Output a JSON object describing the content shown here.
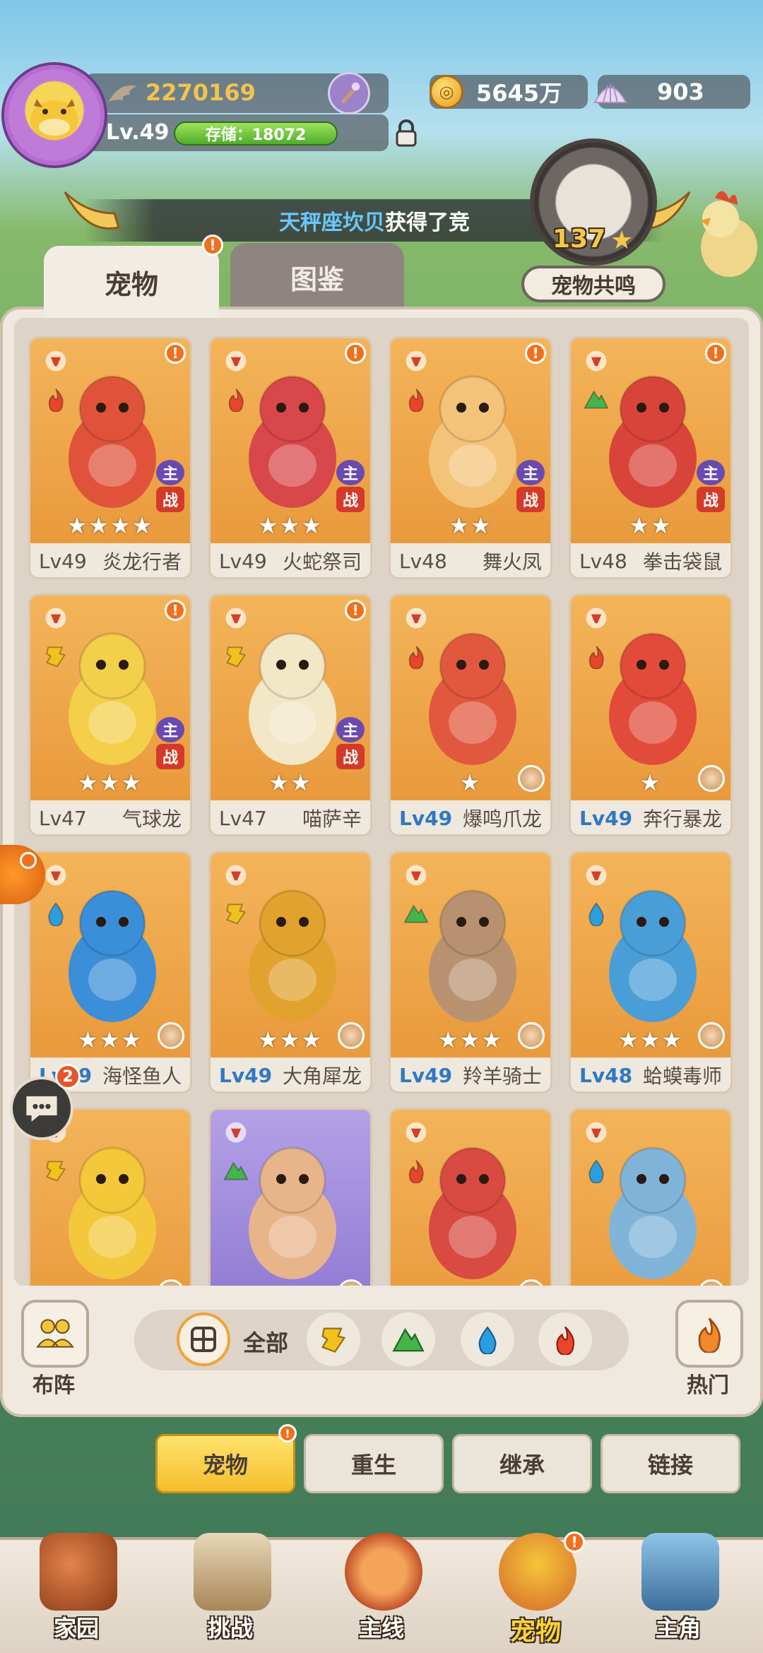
{
  "header": {
    "score": "2270169",
    "level": "Lv.49",
    "storage": "存储：18072",
    "gold": "5645万",
    "shells": "903"
  },
  "marquee": {
    "highlight": "天秤座坎贝",
    "text": "获得了竞"
  },
  "resonance": {
    "count": "137",
    "label": "宠物共鸣"
  },
  "tabs": [
    {
      "label": "宠物",
      "badge": "!"
    },
    {
      "label": "图鉴"
    }
  ],
  "pets": [
    {
      "lv": "Lv49",
      "name": "炎龙行者",
      "stars": "★★★★",
      "badge": true,
      "main": true
    },
    {
      "lv": "Lv49",
      "name": "火蛇祭司",
      "stars": "★★★",
      "badge": true,
      "main": true
    },
    {
      "lv": "Lv48",
      "name": "舞火凤",
      "stars": "★★",
      "badge": true,
      "main": true
    },
    {
      "lv": "Lv48",
      "name": "拳击袋鼠",
      "stars": "★★",
      "badge": true,
      "main": true
    },
    {
      "lv": "Lv47",
      "name": "气球龙",
      "stars": "★★★",
      "badge": true,
      "main": true
    },
    {
      "lv": "Lv47",
      "name": "喵萨辛",
      "stars": "★★",
      "badge": true,
      "main": true
    },
    {
      "lv": "Lv49",
      "name": "爆鸣爪龙",
      "stars": "★",
      "lvBlue": true
    },
    {
      "lv": "Lv49",
      "name": "奔行暴龙",
      "stars": "★",
      "lvBlue": true
    },
    {
      "lv": "Lv49",
      "name": "海怪鱼人",
      "stars": "★★★",
      "lvBlue": true
    },
    {
      "lv": "Lv49",
      "name": "大角犀龙",
      "stars": "★★★",
      "lvBlue": true
    },
    {
      "lv": "Lv49",
      "name": "羚羊骑士",
      "stars": "★★★",
      "lvBlue": true
    },
    {
      "lv": "Lv48",
      "name": "蛤蟆毒师",
      "stars": "★★★",
      "lvBlue": true
    },
    {
      "lv": "",
      "name": "",
      "stars": ""
    },
    {
      "lv": "",
      "name": "",
      "stars": "",
      "purple": true
    },
    {
      "lv": "",
      "name": "",
      "stars": ""
    },
    {
      "lv": "",
      "name": "",
      "stars": ""
    }
  ],
  "battle": {
    "main": "主",
    "fight": "战"
  },
  "chat_badge": "2",
  "filters": {
    "formation": "布阵",
    "all": "全部",
    "hot": "热门"
  },
  "subtabs": [
    {
      "label": "宠物"
    },
    {
      "label": "重生"
    },
    {
      "label": "继承"
    },
    {
      "label": "链接"
    }
  ],
  "nav": [
    {
      "label": "家园"
    },
    {
      "label": "挑战"
    },
    {
      "label": "主线"
    },
    {
      "label": "宠物"
    },
    {
      "label": "主角"
    }
  ],
  "colors": {
    "accent": "#f4be2d",
    "fire": "#e8452a",
    "water": "#2b9ee0",
    "earth": "#44b54a",
    "thunder": "#f2c21c"
  }
}
